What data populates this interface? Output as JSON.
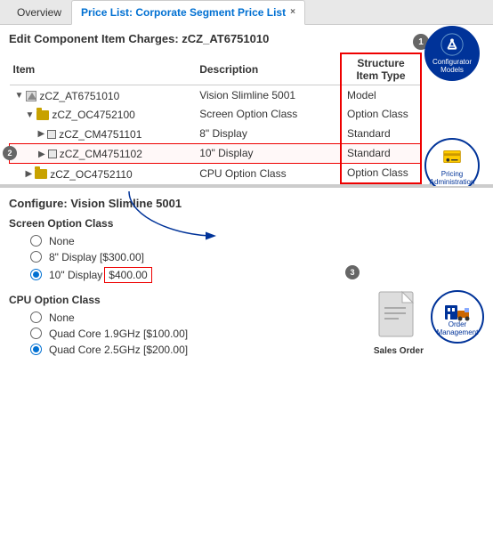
{
  "tabs": [
    {
      "label": "Overview",
      "active": false,
      "closable": false
    },
    {
      "label": "Price List: Corporate Segment Price List",
      "active": true,
      "closable": true
    }
  ],
  "edit_title": "Edit Component Item Charges: zCZ_AT6751010",
  "table": {
    "columns": [
      "Item",
      "Description",
      "Structure Item Type"
    ],
    "rows": [
      {
        "indent": 0,
        "icon": "model",
        "item": "zCZ_AT6751010",
        "description": "Vision Slimline 5001",
        "structure": "Model",
        "highlighted": false
      },
      {
        "indent": 1,
        "icon": "folder",
        "item": "zCZ_OC4752100",
        "description": "Screen Option Class",
        "structure": "Option Class",
        "highlighted": false
      },
      {
        "indent": 2,
        "icon": "component",
        "item": "zCZ_CM4751101",
        "description": "8\" Display",
        "structure": "Standard",
        "highlighted": false
      },
      {
        "indent": 2,
        "icon": "component",
        "item": "zCZ_CM4751102",
        "description": "10\" Display",
        "structure": "Standard",
        "highlighted": true
      },
      {
        "indent": 1,
        "icon": "folder",
        "item": "zCZ_OC4752110",
        "description": "CPU Option Class",
        "structure": "Option Class",
        "highlighted": false
      }
    ]
  },
  "badges": {
    "b1": "1",
    "b2": "2",
    "b3": "3"
  },
  "right_icons": {
    "configurator": {
      "label": "Configurator Models",
      "icon": "wrench"
    },
    "pricing": {
      "label": "Pricing Administration",
      "icon": "tag"
    }
  },
  "bottom": {
    "configure_title": "Configure: Vision Slimline 5001",
    "option_groups": [
      {
        "label": "Screen Option Class",
        "options": [
          {
            "label": "None",
            "selected": false,
            "price": null
          },
          {
            "label": "8\" Display [$300.00]",
            "selected": false,
            "price": null
          },
          {
            "label": "10\" Display",
            "selected": true,
            "price": "$400.00",
            "price_highlighted": true
          }
        ]
      },
      {
        "label": "CPU Option Class",
        "options": [
          {
            "label": "None",
            "selected": false,
            "price": null
          },
          {
            "label": "Quad Core 1.9GHz [$100.00]",
            "selected": false,
            "price": null
          },
          {
            "label": "Quad Core 2.5GHz [$200.00]",
            "selected": true,
            "price": null
          }
        ]
      }
    ],
    "sales_order_label": "Sales Order",
    "order_mgmt_label": "Order Management"
  }
}
